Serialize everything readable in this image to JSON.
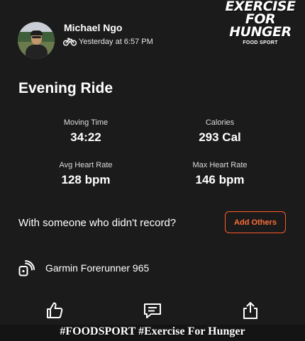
{
  "header": {
    "user_name": "Michael Ngo",
    "activity_icon": "bicycle-icon",
    "timestamp": "Yesterday at 6:57 PM"
  },
  "watermark": {
    "line1": "EXERCISE",
    "line2": "FOR",
    "line3": "HUNGER",
    "small": "FOOD SPORT"
  },
  "activity": {
    "title": "Evening Ride"
  },
  "stats": [
    {
      "label": "Moving Time",
      "value": "34:22"
    },
    {
      "label": "Calories",
      "value": "293 Cal"
    },
    {
      "label": "Avg Heart Rate",
      "value": "128 bpm"
    },
    {
      "label": "Max Heart Rate",
      "value": "146 bpm"
    }
  ],
  "others": {
    "prompt": "With someone who didn't record?",
    "button_label": "Add Others"
  },
  "device": {
    "icon": "device-sync-icon",
    "name": "Garmin Forerunner 965"
  },
  "actions": {
    "kudos_icon": "thumbs-up-icon",
    "comment_icon": "comment-icon",
    "share_icon": "share-icon"
  },
  "footer": {
    "hashtags": "#FOODSPORT #Exercise For Hunger"
  },
  "colors": {
    "background": "#1b1b1b",
    "accent": "#fc5a2a",
    "text": "#ffffff"
  }
}
